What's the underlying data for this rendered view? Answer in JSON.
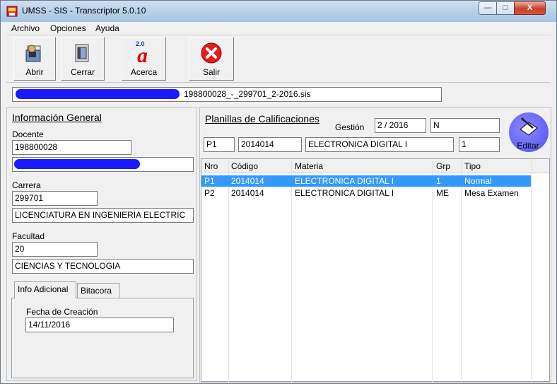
{
  "window": {
    "title": "UMSS - SIS - Transcriptor 5.0.10",
    "minimize": "—",
    "maximize": "□",
    "close": "X"
  },
  "menu": [
    "Archivo",
    "Opciones",
    "Ayuda"
  ],
  "toolbar": {
    "abrir": "Abrir",
    "cerrar": "Cerrar",
    "acerca": "Acerca",
    "acerca_badge": "2.0",
    "salir": "Salir"
  },
  "file_path": "198800028_-_299701_2-2016.sis",
  "info": {
    "heading": "Información General",
    "docente_label": "Docente",
    "docente_code": "198800028",
    "carrera_label": "Carrera",
    "carrera_code": "299701",
    "carrera_name": "LICENCIATURA EN INGENIERIA ELECTRIC",
    "facultad_label": "Facultad",
    "facultad_code": "20",
    "facultad_name": "CIENCIAS Y TECNOLOGIA"
  },
  "tabs": [
    "Info Adicional",
    "Bitacora"
  ],
  "info_adicional": {
    "fecha_label": "Fecha de Creación",
    "fecha_value": "14/11/2016"
  },
  "planillas": {
    "heading": "Planillas de Calificaciones",
    "gestion_label": "Gestión",
    "gestion_value": "2 / 2016",
    "gestion_flag": "N",
    "sel_nro": "P1",
    "sel_codigo": "2014014",
    "sel_materia": "ELECTRONICA DIGITAL I",
    "sel_grp": "1",
    "editar": "Editar"
  },
  "table": {
    "headers": [
      "Nro",
      "Código",
      "Materia",
      "Grp",
      "Tipo"
    ],
    "rows": [
      [
        "P1",
        "2014014",
        "ELECTRONICA DIGITAL I",
        "1",
        "Normal"
      ],
      [
        "P2",
        "2014014",
        "ELECTRONICA DIGITAL I",
        "ME",
        "Mesa Examen"
      ]
    ]
  }
}
